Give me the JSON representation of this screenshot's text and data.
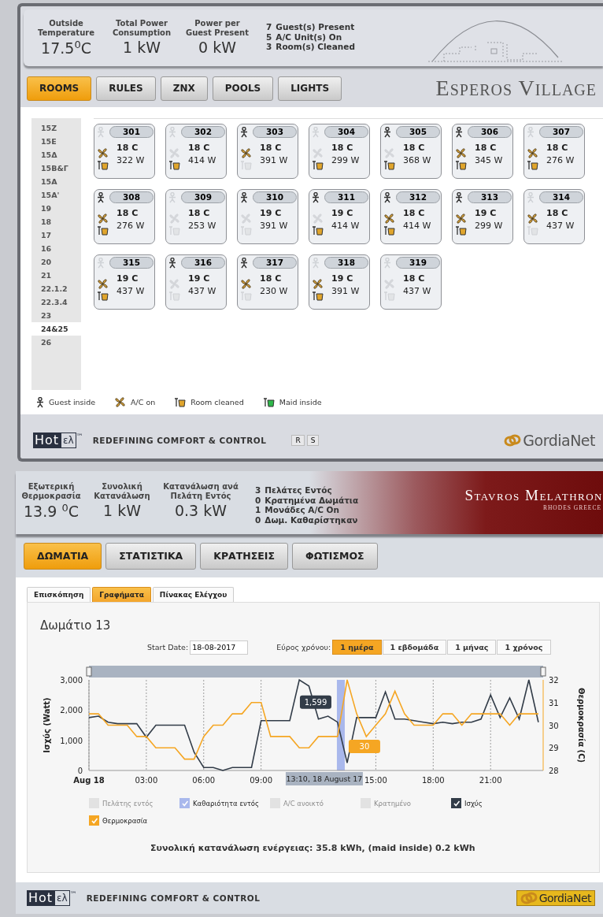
{
  "dashboard_1": {
    "header": {
      "stats": [
        {
          "label": "Outside\nTemperature",
          "value": "17.5$^{0}$C"
        },
        {
          "label": "Total Power\nConsumption",
          "value": "1 kW"
        },
        {
          "label": "Power per\nGuest Present",
          "value": "0 kW"
        }
      ],
      "summary": [
        {
          "count": "7",
          "text": "Guest(s) Present"
        },
        {
          "count": "5",
          "text": "A/C Unit(s) On"
        },
        {
          "count": "3",
          "text": "Room(s) Cleaned"
        }
      ]
    },
    "tabs": [
      {
        "label": "ROOMS",
        "selected": true
      },
      {
        "label": "RULES",
        "selected": false
      },
      {
        "label": "ZNX",
        "selected": false
      },
      {
        "label": "POOLS",
        "selected": false
      },
      {
        "label": "LIGHTS",
        "selected": false
      }
    ],
    "site_title": "Esperos Village",
    "buildings": [
      {
        "label": "15Ζ",
        "selected": false
      },
      {
        "label": "15Ε",
        "selected": false
      },
      {
        "label": "15Δ",
        "selected": false
      },
      {
        "label": "15Β&Γ",
        "selected": false
      },
      {
        "label": "15Α",
        "selected": false
      },
      {
        "label": "15Α'",
        "selected": false
      },
      {
        "label": "19",
        "selected": false
      },
      {
        "label": "18",
        "selected": false
      },
      {
        "label": "17",
        "selected": false
      },
      {
        "label": "16",
        "selected": false
      },
      {
        "label": "20",
        "selected": false
      },
      {
        "label": "21",
        "selected": false
      },
      {
        "label": "22.1.2",
        "selected": false
      },
      {
        "label": "22.3.4",
        "selected": false
      },
      {
        "label": "23",
        "selected": false
      },
      {
        "label": "24&25",
        "selected": true
      },
      {
        "label": "26",
        "selected": false
      }
    ],
    "rooms": [
      {
        "number": "301",
        "guest": false,
        "ac": true,
        "cleaned": true,
        "temperature": "18 C",
        "power": "322 W"
      },
      {
        "number": "302",
        "guest": false,
        "ac": false,
        "cleaned": true,
        "temperature": "18 C",
        "power": "414 W"
      },
      {
        "number": "303",
        "guest": true,
        "ac": true,
        "cleaned": false,
        "temperature": "18 C",
        "power": "391 W"
      },
      {
        "number": "304",
        "guest": false,
        "ac": false,
        "cleaned": true,
        "temperature": "18 C",
        "power": "299 W"
      },
      {
        "number": "305",
        "guest": true,
        "ac": false,
        "cleaned": true,
        "temperature": "18 C",
        "power": "368 W"
      },
      {
        "number": "306",
        "guest": true,
        "ac": true,
        "cleaned": true,
        "temperature": "18 C",
        "power": "345 W"
      },
      {
        "number": "307",
        "guest": false,
        "ac": true,
        "cleaned": true,
        "temperature": "18 C",
        "power": "276 W"
      },
      {
        "number": "308",
        "guest": true,
        "ac": true,
        "cleaned": true,
        "temperature": "18 C",
        "power": "276 W"
      },
      {
        "number": "309",
        "guest": false,
        "ac": false,
        "cleaned": false,
        "temperature": "18 C",
        "power": "253 W"
      },
      {
        "number": "310",
        "guest": true,
        "ac": false,
        "cleaned": false,
        "temperature": "19 C",
        "power": "391 W"
      },
      {
        "number": "311",
        "guest": true,
        "ac": false,
        "cleaned": true,
        "temperature": "19 C",
        "power": "414 W"
      },
      {
        "number": "312",
        "guest": true,
        "ac": true,
        "cleaned": true,
        "temperature": "18 C",
        "power": "414 W"
      },
      {
        "number": "313",
        "guest": true,
        "ac": true,
        "cleaned": true,
        "temperature": "19 C",
        "power": "299 W"
      },
      {
        "number": "314",
        "guest": false,
        "ac": true,
        "cleaned": false,
        "temperature": "18 C",
        "power": "437 W"
      },
      {
        "number": "315",
        "guest": false,
        "ac": true,
        "cleaned": true,
        "temperature": "19 C",
        "power": "437 W"
      },
      {
        "number": "316",
        "guest": true,
        "ac": false,
        "cleaned": false,
        "temperature": "19 C",
        "power": "437 W"
      },
      {
        "number": "317",
        "guest": true,
        "ac": true,
        "cleaned": false,
        "temperature": "18 C",
        "power": "230 W"
      },
      {
        "number": "318",
        "guest": false,
        "ac": true,
        "cleaned": true,
        "temperature": "19 C",
        "power": "391 W"
      },
      {
        "number": "319",
        "guest": false,
        "ac": false,
        "cleaned": false,
        "temperature": "18 C",
        "power": "437 W"
      }
    ],
    "legend": [
      {
        "kind": "guest",
        "label": "Guest inside"
      },
      {
        "kind": "ac",
        "label": "A/C on"
      },
      {
        "kind": "cleaned",
        "label": "Room cleaned"
      },
      {
        "kind": "maid",
        "label": "Maid inside"
      }
    ],
    "footer": {
      "brand": "Hot",
      "brand_suffix": "ελ",
      "trademark": "™",
      "tagline": "REDEFINING COMFORT & CONTROL",
      "buttons": [
        "R",
        "S"
      ],
      "partner": "GordiaNet",
      "partner_boxed": false
    }
  },
  "dashboard_2": {
    "header": {
      "stats": [
        {
          "label": "Εξωτερική\nΘερμοκρασία",
          "value": "13.9 $^{0}$C"
        },
        {
          "label": "Συνολική\nΚατανάλωση",
          "value": "1 kW"
        },
        {
          "label": "Κατανάλωση ανά\nΠελάτη Εντός",
          "value": "0.3 kW"
        }
      ],
      "summary": [
        {
          "count": "3",
          "text": "Πελάτες Εντός"
        },
        {
          "count": "0",
          "text": "Κρατημένα Δωμάτια"
        },
        {
          "count": "1",
          "text": "Μονάδες A/C On"
        },
        {
          "count": "0",
          "text": "Δωμ. Καθαρίστηκαν"
        }
      ]
    },
    "site_title": "Stavros Melathron",
    "site_subtitle": "RHODES GREECE",
    "tabs": [
      {
        "label": "ΔΩΜΑΤΙΑ",
        "selected": true
      },
      {
        "label": "ΣΤΑΤΙΣΤΙΚΑ",
        "selected": false
      },
      {
        "label": "ΚΡΑΤΗΣΕΙΣ",
        "selected": false
      },
      {
        "label": "ΦΩΤΙΣΜΟΣ",
        "selected": false
      }
    ],
    "sub_tabs": [
      {
        "label": "Επισκόπηση",
        "selected": false
      },
      {
        "label": "Γραφήματα",
        "selected": true
      },
      {
        "label": "Πίνακας Ελέγχου",
        "selected": false
      }
    ],
    "room_title": "Δωμάτιο 13",
    "start_date": {
      "label": "Start Date:",
      "value": "18-08-2017"
    },
    "range": {
      "label": "Εύρος χρόνου:",
      "options": [
        {
          "label": "1 ημέρα",
          "selected": true
        },
        {
          "label": "1 εβδομάδα",
          "selected": false
        },
        {
          "label": "1 μήνας",
          "selected": false
        },
        {
          "label": "1 χρόνος",
          "selected": false
        }
      ]
    },
    "chart_data": {
      "type": "line",
      "ylabel": "Ισχύς (Watt)",
      "y2label": "Θερμοκρασία (C)",
      "x": [
        0,
        0.5,
        1,
        1.5,
        2,
        2.5,
        3,
        3.5,
        4,
        4.5,
        5,
        5.5,
        6,
        6.5,
        7,
        7.5,
        8,
        8.5,
        9,
        9.5,
        10,
        10.5,
        11,
        11.5,
        12,
        12.5,
        13,
        13.5,
        14,
        14.5,
        15,
        15.5,
        16,
        16.5,
        17,
        17.5,
        18,
        18.5,
        19,
        19.5,
        20,
        20.5,
        21,
        21.5,
        22,
        22.5,
        23,
        23.5
      ],
      "xlim": [
        0,
        23.75
      ],
      "ylim": [
        0,
        3000
      ],
      "y2lim": [
        28,
        32
      ],
      "xticks": [
        {
          "value": 0,
          "label": "Aug 18"
        },
        {
          "value": 3,
          "label": "03:00"
        },
        {
          "value": 6,
          "label": "06:00"
        },
        {
          "value": 9,
          "label": "09:00"
        },
        {
          "value": 15,
          "label": "15:00"
        },
        {
          "value": 18,
          "label": "18:00"
        },
        {
          "value": 21,
          "label": "21:00"
        }
      ],
      "yticks": [
        {
          "value": 0,
          "label": "0"
        },
        {
          "value": 1000,
          "label": "1,000"
        },
        {
          "value": 2000,
          "label": "2,000"
        },
        {
          "value": 3000,
          "label": "3,000"
        }
      ],
      "y2ticks": [
        28,
        29,
        30,
        31,
        32
      ],
      "series": [
        {
          "name": "Ισχύς",
          "color": "#323c48",
          "values": [
            1750,
            1800,
            1600,
            1550,
            1550,
            1550,
            1100,
            1500,
            1500,
            1500,
            1500,
            600,
            100,
            100,
            0,
            100,
            100,
            100,
            1650,
            1650,
            1650,
            1650,
            3000,
            2800,
            1700,
            1800,
            1600,
            250,
            1750,
            1750,
            1750,
            2600,
            1700,
            1700,
            1650,
            1600,
            1550,
            1600,
            1550,
            1600,
            1600,
            1700,
            2500,
            1750,
            2400,
            1700,
            3000,
            1600
          ]
        },
        {
          "name": "Θερμοκρασία",
          "color": "#f5a623",
          "axis": "y2",
          "values": [
            30.5,
            30.5,
            30,
            30,
            30,
            29.5,
            29.5,
            29,
            29,
            29,
            28.5,
            28.5,
            29.5,
            30,
            30,
            30.5,
            30.5,
            31,
            31,
            29.5,
            29.5,
            29.5,
            29,
            29,
            29.5,
            29.5,
            29.5,
            32,
            30.5,
            29.5,
            30,
            30.5,
            31.5,
            30.5,
            30,
            30,
            30,
            30.5,
            30.5,
            30,
            30.5,
            30.5,
            30.5,
            30.5,
            30,
            30.5,
            30.5,
            30.5
          ]
        }
      ],
      "grid": true,
      "ref_lines": [
        {
          "axis": "x",
          "value": 13.17,
          "label": "13:10, 18 August 17"
        }
      ],
      "annotations": [
        "1,599",
        "30"
      ]
    },
    "series_toggles": [
      {
        "label": "Πελάτης εντός",
        "checked": false,
        "disabled": true,
        "color": "#e2e2e2"
      },
      {
        "label": "Καθαριότητα εντός",
        "checked": true,
        "disabled": false,
        "color": "#a9b8ec"
      },
      {
        "label": "A/C ανοικτό",
        "checked": false,
        "disabled": true,
        "color": "#e2e2e2"
      },
      {
        "label": "Κρατημένο",
        "checked": false,
        "disabled": true,
        "color": "#e2e2e2"
      },
      {
        "checked": true,
        "disabled": false
      },
      {
        "checked": true,
        "disabled": false
      }
    ],
    "total": "Συνολική κατανάλωση ενέργειας: 35.8 kWh, (maid inside) 0.2 kWh",
    "footer": {
      "brand": "Hot",
      "brand_suffix": "ελ",
      "trademark": "™",
      "tagline": "REDEFINING COMFORT & CONTROL",
      "partner": "GordiaNet",
      "partner_boxed": true
    }
  }
}
